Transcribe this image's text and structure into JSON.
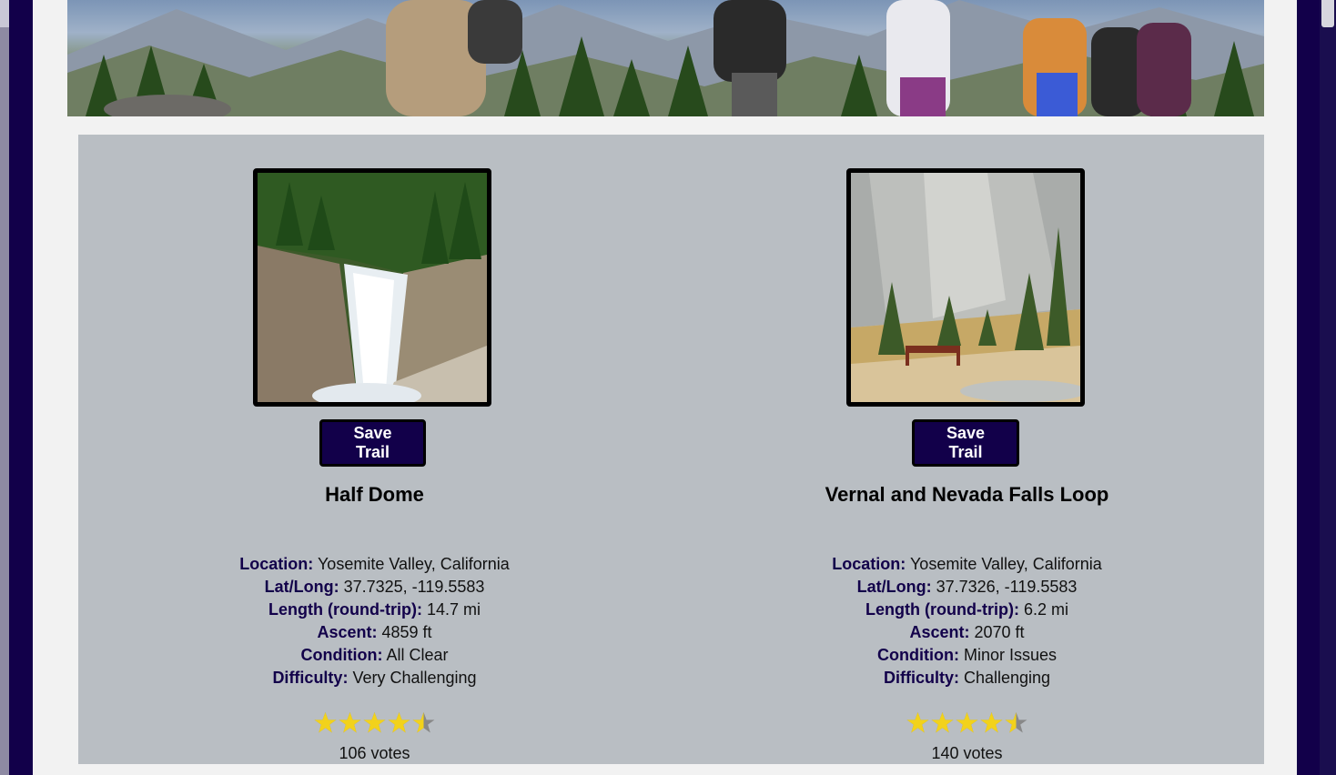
{
  "hero": {
    "icon": "hikers-banner-image"
  },
  "colors": {
    "primary": "#12004a",
    "panel": "#b9bec3",
    "page": "#f2f2f2",
    "star": "#f2d21b",
    "star_empty": "#888888"
  },
  "trails": [
    {
      "name": "Half Dome",
      "save_label": "Save Trail",
      "image": "waterfall-photo",
      "details": [
        {
          "label": "Location:",
          "value": "Yosemite Valley, California"
        },
        {
          "label": "Lat/Long:",
          "value": "37.7325, -119.5583"
        },
        {
          "label": "Length (round-trip):",
          "value": "14.7 mi"
        },
        {
          "label": "Ascent:",
          "value": "4859 ft"
        },
        {
          "label": "Condition:",
          "value": "All Clear"
        },
        {
          "label": "Difficulty:",
          "value": "Very Challenging"
        }
      ],
      "rating": 4.5,
      "votes": "106 votes"
    },
    {
      "name": "Vernal and Nevada Falls Loop",
      "save_label": "Save Trail",
      "image": "granite-cliff-photo",
      "details": [
        {
          "label": "Location:",
          "value": "Yosemite Valley, California"
        },
        {
          "label": "Lat/Long:",
          "value": "37.7326, -119.5583"
        },
        {
          "label": "Length (round-trip):",
          "value": "6.2 mi"
        },
        {
          "label": "Ascent:",
          "value": "2070 ft"
        },
        {
          "label": "Condition:",
          "value": "Minor Issues"
        },
        {
          "label": "Difficulty:",
          "value": "Challenging"
        }
      ],
      "rating": 4.5,
      "votes": "140 votes"
    }
  ]
}
